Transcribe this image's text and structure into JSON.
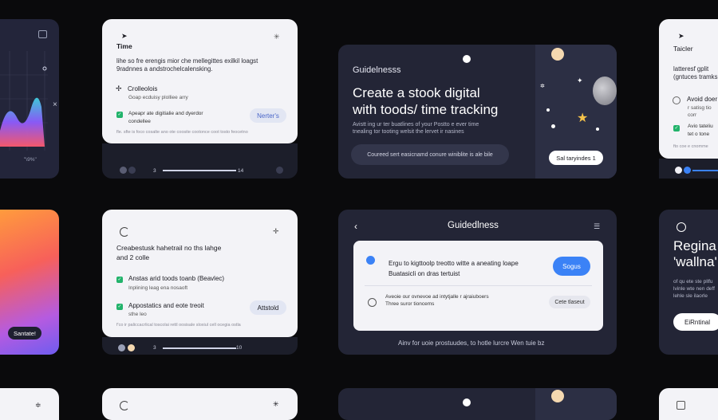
{
  "colors": {
    "bg": "#0a0a0c",
    "card_light": "#f3f3f7",
    "card_dark": "#232536",
    "accent_blue": "#3b82f6",
    "check_green": "#22b36b",
    "star_gold": "#f5c24a"
  },
  "left_top": {
    "corner_icon": "image-icon",
    "close_glyph": "×",
    "label": "\"\\9%\""
  },
  "left_mid": {
    "button": "Santate!"
  },
  "card_a": {
    "title": "Time",
    "sparkle": "✳",
    "desc_line1": "lihe so fre erengis mior che mellegittes exilkil loagst",
    "desc_line2": "9radnnes a andstrochelcalensking.",
    "item1_title": "Crolleolois",
    "item1_sub": "Goap ecduisy plolliee arry",
    "item2_title": "Apeapr ate digitialie and dyerdor",
    "item2_sub": "condellee",
    "button": "Nerter's",
    "footer": "fle. sfte is foco cosalte ano ote coosite cootonce coot tosto feocetno",
    "player_num_left": "3",
    "player_num_right": "14"
  },
  "card_b": {
    "header": "Guidelnesss",
    "title_line1": "Create a stook digital",
    "title_line2": "with toods/ time tracking",
    "desc_line1": "Avistt ing ur ter buatlines of your Postto e ever time",
    "desc_line2": "tnealing tor tooting welsit the lervet ir nasines",
    "bar_text": "Coureed sert easicnamd conure winiblite is ale bile",
    "button": "Sal taryindes 1"
  },
  "right_top": {
    "title": "Taicler",
    "line1": "latteresf gplit",
    "line2": "(gntuces tramks",
    "item1": "Avoid doer",
    "item1_sub": "r satisg tio corr",
    "item2": "Avio tateliu",
    "item2_sub": "tet o tone",
    "footer": "fto coe e cnomme"
  },
  "card_c": {
    "title_line1": "Creabestusk hahetrail no ths lahge",
    "title_line2": "and  2 colle",
    "item1_title": "Anstas arid toods toanb (Beavlec)",
    "item1_sub": "Inplining leag ena nosaoft",
    "item2_title": "Appostatics and eote treoit",
    "item2_sub": "sthe leo",
    "button": "Attstold",
    "footer": "f'co ir paliccacrlical toscolai rettl oosisale sloxiul cell ocegia ostla",
    "player_num_left": "3",
    "player_num_right": "10"
  },
  "card_d": {
    "header": "Guidedlness",
    "inner_title_line1": "Ergu to kigttoolp treotto witte a aneating loape",
    "inner_title_line2": "Buatasicli on dras tertuist",
    "button": "Sogus",
    "row_line1": "Aveoie our ovnevoe ad intytjalle r ajraiuboers",
    "row_line2": "Three suror tioncems",
    "row_button": "Cete tlaseut",
    "caption": "Ainv for uoie prostuudes, to hotle lurcre Wen tuie bz"
  },
  "right_mid": {
    "title_line1": "Regina",
    "title_line2": "'wallna'",
    "desc_line1": "of qu ete ste pllfu",
    "desc_line2": "lvinle wte nen deff",
    "desc_line3": "lehle sle ilaorle",
    "button": "EiRntinal"
  }
}
